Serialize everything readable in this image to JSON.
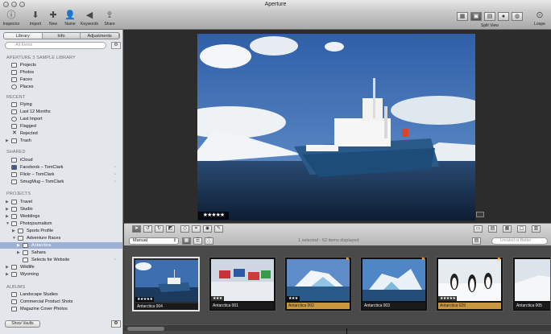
{
  "app": {
    "title": "Aperture"
  },
  "toolbar": {
    "buttons": [
      {
        "label": "Inspector",
        "icon": "info-icon"
      },
      {
        "label": "Import",
        "icon": "import-arrow-icon"
      },
      {
        "label": "New",
        "icon": "plus-icon"
      },
      {
        "label": "Name",
        "icon": "person-icon"
      },
      {
        "label": "Keywords",
        "icon": "tag-icon"
      },
      {
        "label": "Share",
        "icon": "share-icon"
      }
    ],
    "split_view_label": "Split View",
    "loupe_label": "Loupe",
    "view_buttons": [
      "grid-view-icon",
      "split-view-icon",
      "viewer-icon",
      "faces-icon",
      "places-icon"
    ]
  },
  "sidebar": {
    "tabs": [
      "Library",
      "Info",
      "Adjustments"
    ],
    "search_placeholder": "All Items",
    "sections": [
      {
        "title": "APERTURE 3 SAMPLE LIBRARY",
        "items": [
          "Projects",
          "Photos",
          "Faces",
          "Places"
        ]
      },
      {
        "title": "RECENT",
        "items": [
          "Flying",
          "Last 12 Months",
          "Last Import",
          "Flagged",
          "Rejected",
          "Trash"
        ]
      },
      {
        "title": "SHARED",
        "items": [
          "iCloud",
          "Facebook – TomClark",
          "Flickr – TomClark",
          "SmugMug – TomClark"
        ]
      },
      {
        "title": "PROJECTS",
        "items": [
          "Travel",
          "Studio",
          "Weddings",
          "Photojournalism",
          "Sports Profile",
          "Adventure Races",
          "Antarctica",
          "Sahara",
          "Selects for Website",
          "Wildlife",
          "Wyoming"
        ]
      },
      {
        "title": "ALBUMS",
        "items": [
          "Landscape Studies",
          "Commercial Product Shots",
          "Magazine Cover Photos"
        ]
      }
    ],
    "selected_item": "Antarctica",
    "show_vaults_label": "Show Vaults"
  },
  "viewer": {
    "rating": "★★★★★"
  },
  "controls": {
    "sort_label": "Manual",
    "status": "1 selected - 62 items displayed",
    "rating_filter": "Unrated or Better"
  },
  "filmstrip": {
    "items": [
      {
        "name": "Antarctica 004",
        "stars": "★★★★★",
        "label_color": "none",
        "selected": true
      },
      {
        "name": "Antarctica 001",
        "stars": "★★★",
        "label_color": "none",
        "selected": false
      },
      {
        "name": "Antarctica 002",
        "stars": "★★★",
        "label_color": "orange",
        "selected": false
      },
      {
        "name": "Antarctica 003",
        "stars": "",
        "label_color": "none",
        "selected": false
      },
      {
        "name": "Antarctica 029",
        "stars": "★★★★★",
        "label_color": "orange",
        "selected": false
      },
      {
        "name": "Antarctica 005",
        "stars": "",
        "label_color": "none",
        "selected": false
      }
    ]
  },
  "colors": {
    "selection": "#9cb0d3",
    "label_orange": "#c8963e",
    "flag": "#e8a23a"
  }
}
